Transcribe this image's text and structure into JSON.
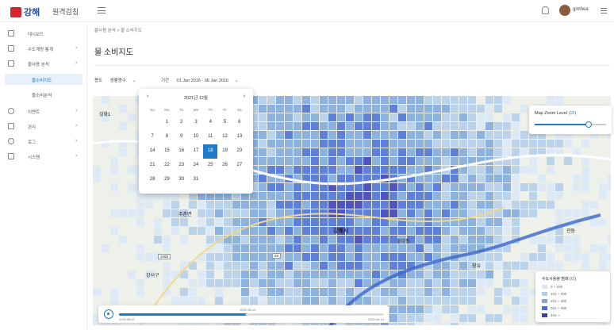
{
  "header": {
    "logo_text": "강해",
    "app_title": "원격검침",
    "username": "gimhea"
  },
  "sidebar": {
    "items": [
      {
        "label": "대시보드",
        "icon": "monitor-icon"
      },
      {
        "label": "수도계량 통계",
        "icon": "meter-icon",
        "has_children": true
      },
      {
        "label": "물사용 분석",
        "icon": "analysis-icon",
        "has_children": true,
        "expanded": true
      },
      {
        "label": "이벤트",
        "icon": "event-icon",
        "has_children": true
      },
      {
        "label": "관리",
        "icon": "manage-icon",
        "has_children": true
      },
      {
        "label": "로그",
        "icon": "log-icon",
        "has_children": true
      },
      {
        "label": "시스템",
        "icon": "system-icon",
        "has_children": true
      }
    ],
    "subitems": [
      {
        "label": "물소비지도",
        "active": true
      },
      {
        "label": "물소비분석",
        "active": false
      }
    ]
  },
  "breadcrumb": "물사용 분석 > 물 소비지도",
  "page_title": "물 소비지도",
  "filters": {
    "type_label": "용도",
    "type_value": "생활용수",
    "period_label": "기간",
    "period_value": "01 Jan 2016 - 06 Jan 2016"
  },
  "calendar": {
    "title": "2021년 12월",
    "prev": "‹",
    "next": "›",
    "weekdays": [
      "Su",
      "Mo",
      "Tu",
      "We",
      "Th",
      "Fr",
      "Sa"
    ],
    "weeks": [
      [
        "",
        "1",
        "2",
        "3",
        "4",
        "5",
        "6"
      ],
      [
        "7",
        "8",
        "9",
        "10",
        "11",
        "12",
        "13"
      ],
      [
        "14",
        "15",
        "16",
        "17",
        "18",
        "19",
        "20"
      ],
      [
        "21",
        "22",
        "23",
        "24",
        "25",
        "26",
        "27"
      ],
      [
        "28",
        "29",
        "30",
        "31",
        "",
        "",
        ""
      ]
    ],
    "selected_day": "18"
  },
  "map": {
    "zoom_label": "Map Zoom Level",
    "zoom_value": "(15)",
    "zoom_fraction": 0.75,
    "city_labels": [
      "강화1",
      "주촌면",
      "강서구",
      "강해시",
      "불암동",
      "장유",
      "관동"
    ],
    "road_badges": [
      "1088",
      "58"
    ],
    "legend_title": "수도사용량 범례 (ㅁ)",
    "legend": [
      {
        "label": "0 ~ 100",
        "color": "#dbe7f5"
      },
      {
        "label": "101 ~ 200",
        "color": "#b3cde9"
      },
      {
        "label": "201 ~ 300",
        "color": "#7fa9dc"
      },
      {
        "label": "301 ~ 400",
        "color": "#4a6fd6"
      },
      {
        "label": "401 ~",
        "color": "#3a3fb6"
      }
    ]
  },
  "timeline": {
    "current": "2020.08.13",
    "start": "2020.08.07",
    "end": "2020.08.14",
    "progress": 0.48
  }
}
